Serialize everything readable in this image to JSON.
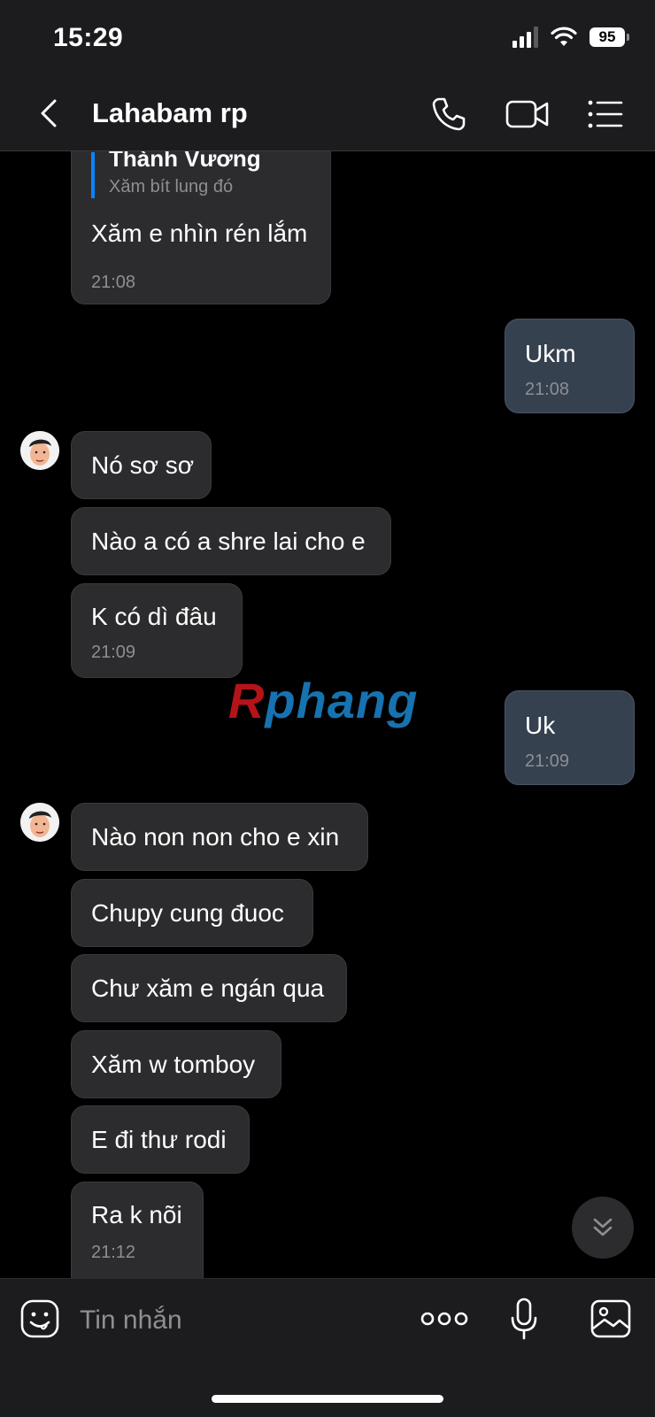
{
  "status_bar": {
    "time": "15:29",
    "battery": "95"
  },
  "header": {
    "title": "Lahabam rp"
  },
  "watermark": {
    "text": "Rphang"
  },
  "messages": [
    {
      "side": "them",
      "quote_name": "Thành Vương",
      "quote_text": "Xăm bít lung đó",
      "text": "Xăm e nhìn rén lắm",
      "time": "21:08"
    },
    {
      "side": "me",
      "text": "Ukm",
      "time": "21:08"
    },
    {
      "side": "them",
      "text": "Nó sơ sơ"
    },
    {
      "side": "them",
      "text": "Nào a có a shre lai cho e"
    },
    {
      "side": "them",
      "text": "K có dì đâu",
      "time": "21:09"
    },
    {
      "side": "me",
      "text": "Uk",
      "time": "21:09"
    },
    {
      "side": "them",
      "text": "Nào non non cho e xin"
    },
    {
      "side": "them",
      "text": "Chupy cung đuoc"
    },
    {
      "side": "them",
      "text": "Chư xăm e ngán qua"
    },
    {
      "side": "them",
      "text": "Xăm w tomboy"
    },
    {
      "side": "them",
      "text": "E đi thư rodi"
    },
    {
      "side": "them",
      "text": "Ra k nõi",
      "time": "21:12"
    }
  ],
  "composer": {
    "placeholder": "Tin nhắn"
  },
  "colors": {
    "accent": "#0a84ff",
    "my_bubble": "#36414f",
    "their_bubble": "#2c2c2e"
  },
  "icons": [
    "back-icon",
    "phone-icon",
    "video-icon",
    "list-icon",
    "sticker-icon",
    "more-icon",
    "mic-icon",
    "image-icon",
    "chevron-down-icon"
  ]
}
